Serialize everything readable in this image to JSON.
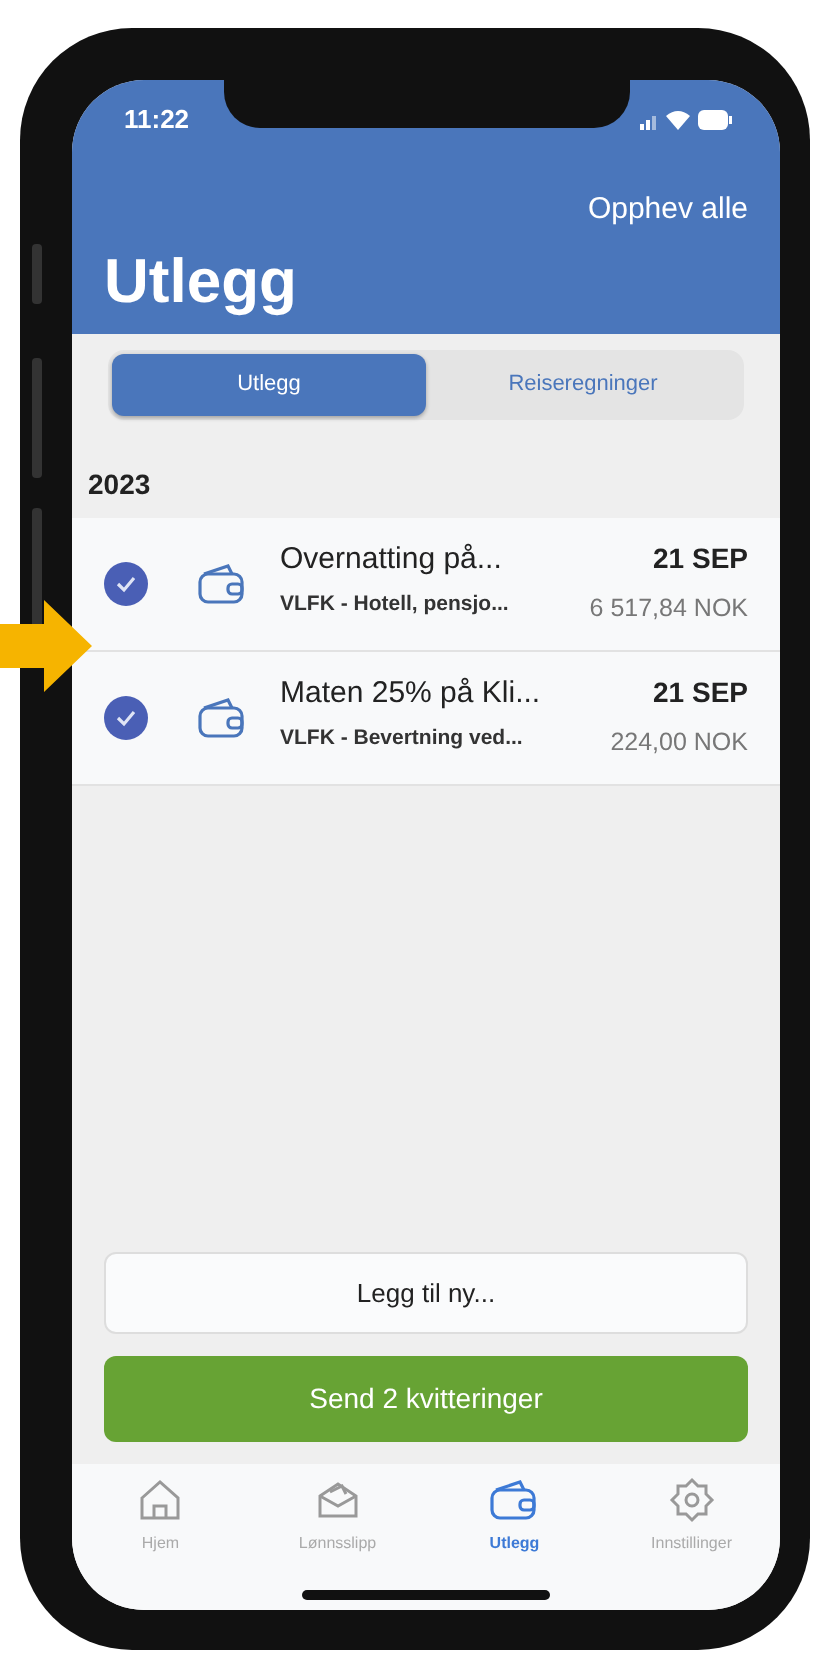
{
  "status_bar": {
    "time": "11:22"
  },
  "header": {
    "action": "Opphev alle",
    "title": "Utlegg"
  },
  "segments": [
    {
      "label": "Utlegg",
      "selected": true
    },
    {
      "label": "Reiseregninger",
      "selected": false
    }
  ],
  "section": "2023",
  "items": [
    {
      "checked": true,
      "title": "Overnatting på...",
      "subtitle": "VLFK - Hotell, pensjo...",
      "date": "21 SEP",
      "amount": "6 517,84 NOK"
    },
    {
      "checked": true,
      "title": "Maten 25% på Kli...",
      "subtitle": "VLFK - Bevertning ved...",
      "date": "21 SEP",
      "amount": "224,00 NOK"
    }
  ],
  "add_button": "Legg til ny...",
  "send_button": "Send 2 kvitteringer",
  "tab_bar": [
    {
      "label": "Hjem",
      "kind": "home",
      "selected": false
    },
    {
      "label": "Lønnsslipp",
      "kind": "payslip",
      "selected": false
    },
    {
      "label": "Utlegg",
      "kind": "wallet",
      "selected": true
    },
    {
      "label": "Innstillinger",
      "kind": "settings",
      "selected": false
    }
  ]
}
